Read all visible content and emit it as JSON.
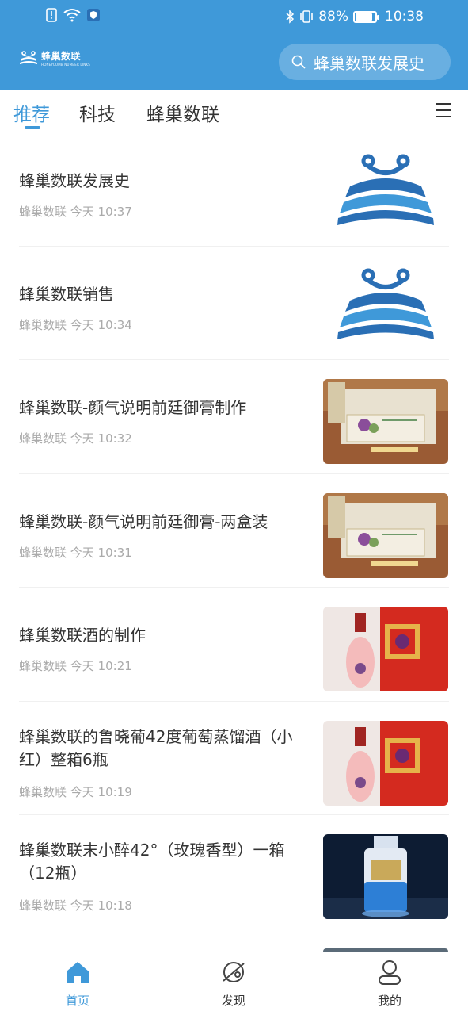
{
  "status_bar": {
    "battery": "88%",
    "battery_level": 0.88,
    "time": "10:38",
    "icons": [
      "alert-icon",
      "wifi-icon",
      "shield-icon",
      "bluetooth-icon",
      "vibrate-icon"
    ]
  },
  "header": {
    "brand_name": "蜂巢数联",
    "brand_sub": "HONEYCOMB NUMBER LINKS",
    "search_text": "蜂巢数联发展史",
    "color": "#3f99d9"
  },
  "tabs": [
    {
      "label": "推荐",
      "active": true
    },
    {
      "label": "科技",
      "active": false
    },
    {
      "label": "蜂巢数联",
      "active": false
    }
  ],
  "feed": [
    {
      "title": "蜂巢数联发展史",
      "source": "蜂巢数联",
      "time": "今天 10:37",
      "thumb": "honeycomb-logo"
    },
    {
      "title": "蜂巢数联销售",
      "source": "蜂巢数联",
      "time": "今天 10:34",
      "thumb": "honeycomb-logo"
    },
    {
      "title": "蜂巢数联-颜气说明前廷御膏制作",
      "source": "蜂巢数联",
      "time": "今天 10:32",
      "thumb": "paste-box"
    },
    {
      "title": "蜂巢数联-颜气说明前廷御膏-两盒装",
      "source": "蜂巢数联",
      "time": "今天 10:31",
      "thumb": "paste-box"
    },
    {
      "title": "蜂巢数联酒的制作",
      "source": "蜂巢数联",
      "time": "今天 10:21",
      "thumb": "wine-red-box"
    },
    {
      "title": "蜂巢数联的鲁晓葡42度葡萄蒸馏酒（小红）整箱6瓶",
      "source": "蜂巢数联",
      "time": "今天 10:19",
      "thumb": "wine-red-box"
    },
    {
      "title": "蜂巢数联末小醉42°（玫瑰香型）一箱（12瓶）",
      "source": "蜂巢数联",
      "time": "今天 10:18",
      "thumb": "liquor-blue-bottle"
    }
  ],
  "bottom_nav": [
    {
      "label": "首页",
      "icon": "home-icon",
      "active": true
    },
    {
      "label": "发现",
      "icon": "discover-icon",
      "active": false
    },
    {
      "label": "我的",
      "icon": "profile-icon",
      "active": false
    }
  ]
}
